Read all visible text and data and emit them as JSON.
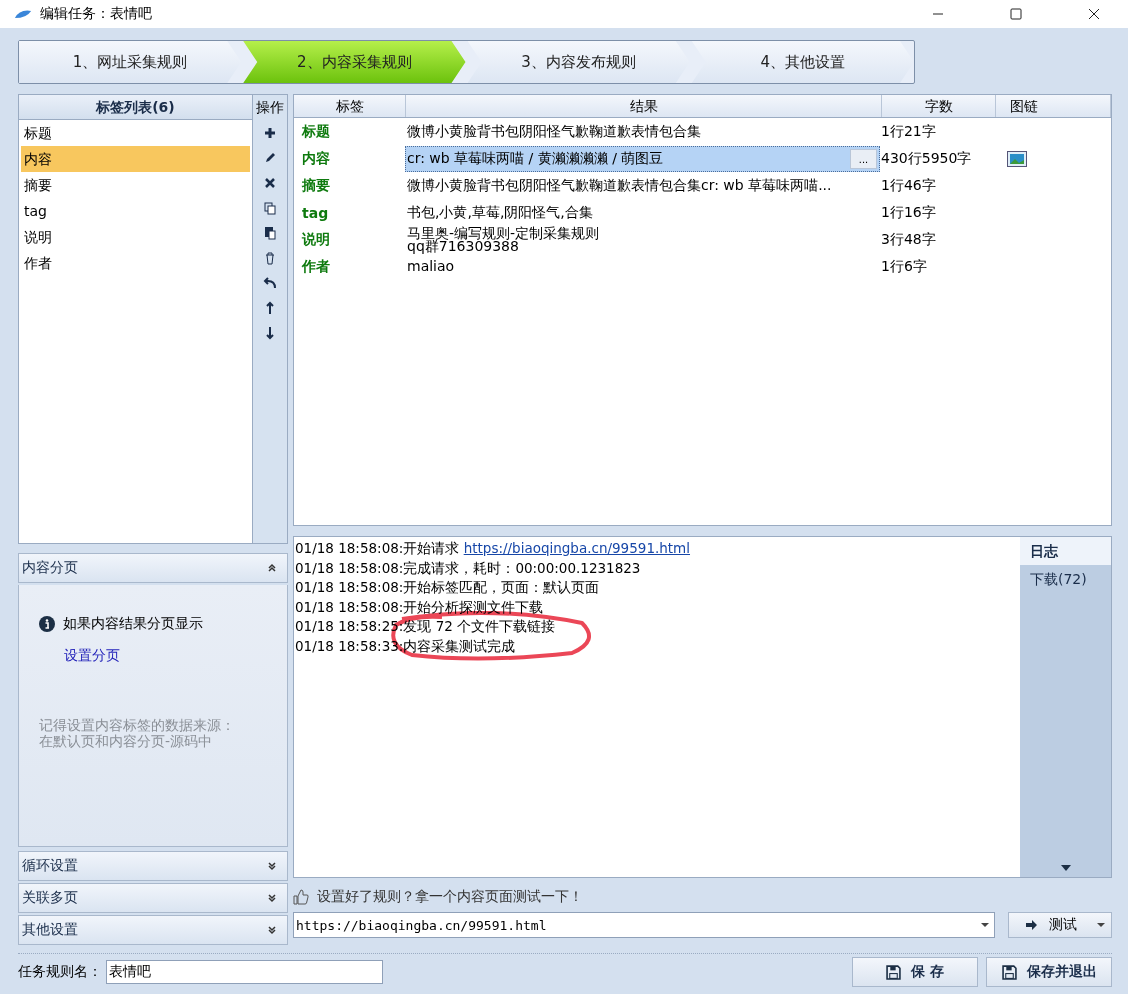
{
  "window": {
    "title": "编辑任务：表情吧"
  },
  "tabs": [
    {
      "label": "1、网址采集规则",
      "selected": false
    },
    {
      "label": "2、内容采集规则",
      "selected": true
    },
    {
      "label": "3、内容发布规则",
      "selected": false
    },
    {
      "label": "4、其他设置",
      "selected": false
    }
  ],
  "tag_list": {
    "title": "标签列表(6)",
    "items": [
      {
        "label": "标题",
        "selected": false
      },
      {
        "label": "内容",
        "selected": true
      },
      {
        "label": "摘要",
        "selected": false
      },
      {
        "label": "tag",
        "selected": false
      },
      {
        "label": "说明",
        "selected": false
      },
      {
        "label": "作者",
        "selected": false
      }
    ]
  },
  "operations": {
    "title": "操作"
  },
  "sections": [
    {
      "title": "内容分页",
      "expanded": true
    },
    {
      "title": "循环设置",
      "expanded": false
    },
    {
      "title": "关联多页",
      "expanded": false
    },
    {
      "title": "其他设置",
      "expanded": false
    }
  ],
  "pagination_help": {
    "info": "如果内容结果分页显示",
    "link": "设置分页",
    "note": [
      "记得设置内容标签的数据来源：",
      "在默认页和内容分页-源码中"
    ]
  },
  "results_table": {
    "columns": [
      "标签",
      "结果",
      "字数",
      "图链"
    ],
    "rows": [
      {
        "tag": "标题",
        "result": [
          "微博小黄脸背书包阴阳怪气歉鞠道歉表情包合集"
        ],
        "count": "1行21字",
        "selected": false,
        "image_link": false
      },
      {
        "tag": "内容",
        "result": [
          "cr: wb 草莓味两喵 / 黄濑濑濑濑 / 萌图豆"
        ],
        "count": "430行5950字",
        "selected": true,
        "image_link": true,
        "more": "..."
      },
      {
        "tag": "摘要",
        "result": [
          "微博小黄脸背书包阴阳怪气歉鞠道歉表情包合集cr: wb 草莓味两喵..."
        ],
        "count": "1行46字",
        "selected": false,
        "image_link": false
      },
      {
        "tag": "tag",
        "result": [
          "书包,小黄,草莓,阴阳怪气,合集"
        ],
        "count": "1行16字",
        "selected": false,
        "image_link": false
      },
      {
        "tag": "说明",
        "result": [
          "马里奥-编写规则-定制采集规则",
          "qq群716309388"
        ],
        "count": "3行48字",
        "selected": false,
        "image_link": false
      },
      {
        "tag": "作者",
        "result": [
          "maliao"
        ],
        "count": "1行6字",
        "selected": false,
        "image_link": false
      }
    ]
  },
  "log": {
    "lines": [
      {
        "text": "01/18 18:58:08:开始请求 ",
        "link": "https://biaoqingba.cn/99591.html"
      },
      {
        "text": "01/18 18:58:08:完成请求，耗时：00:00:00.1231823"
      },
      {
        "text": "01/18 18:58:08:开始标签匹配，页面：默认页面"
      },
      {
        "text": "01/18 18:58:08:开始分析探测文件下载"
      },
      {
        "text": "01/18 18:58:25:发现 72 个文件下载链接"
      },
      {
        "text": "01/18 18:58:33:内容采集测试完成"
      }
    ],
    "side_tabs": [
      {
        "label": "日志",
        "selected": true
      },
      {
        "label": "下载(72)",
        "selected": false
      }
    ]
  },
  "test_hint": "设置好了规则？拿一个内容页面测试一下！",
  "test_url": "https://biaoqingba.cn/99591.html",
  "test_button": "测试",
  "task_name_label": "任务规则名：",
  "task_name": "表情吧",
  "buttons": [
    "保 存",
    "保存并退出"
  ]
}
